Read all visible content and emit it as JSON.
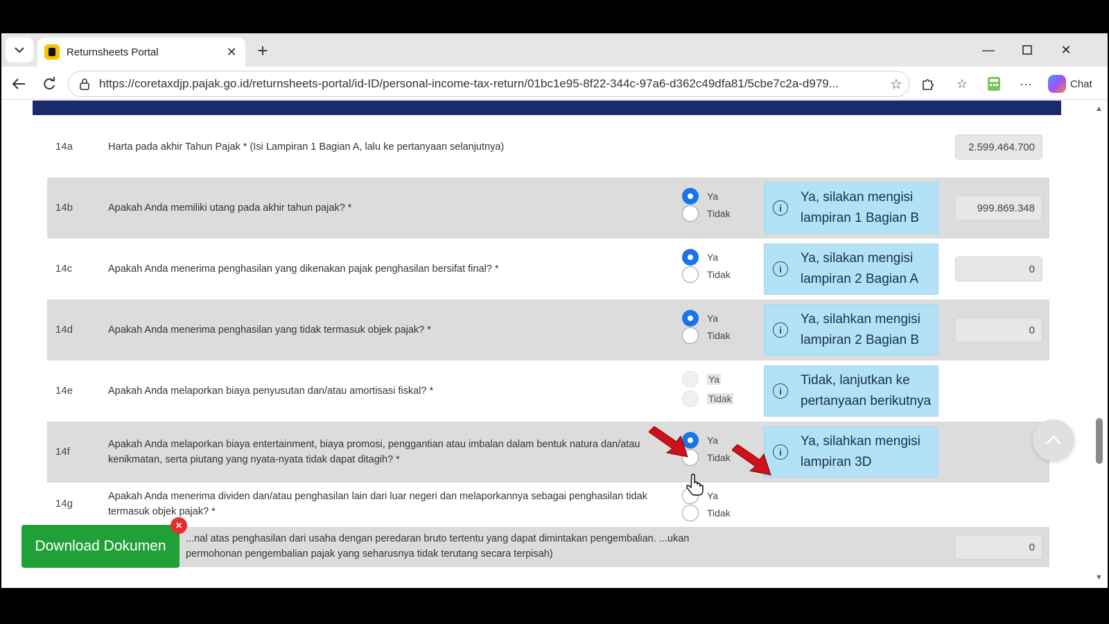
{
  "browser": {
    "tab_title": "Returnsheets Portal",
    "url": "https://coretaxdjp.pajak.go.id/returnsheets-portal/id-ID/personal-income-tax-return/01bc1e95-8f22-344c-97a6-d362c49dfa81/5cbe7c2a-d979...",
    "chat_label": "Chat"
  },
  "form": {
    "yes_label": "Ya",
    "no_label": "Tidak",
    "rows": [
      {
        "no": "14a",
        "question": "Harta pada akhir Tahun Pajak * (Isi Lampiran 1 Bagian A, lalu ke pertanyaan selanjutnya)",
        "amount": "2.599.464.700"
      },
      {
        "no": "14b",
        "question": "Apakah Anda memiliki utang pada akhir tahun pajak? *",
        "selected": "Ya",
        "info": "Ya, silakan mengisi lampiran 1 Bagian B",
        "amount": "999.869.348"
      },
      {
        "no": "14c",
        "question": "Apakah Anda menerima penghasilan yang dikenakan pajak penghasilan bersifat final? *",
        "selected": "Ya",
        "info": "Ya, silakan mengisi lampiran 2 Bagian A",
        "amount": "0"
      },
      {
        "no": "14d",
        "question": "Apakah Anda menerima penghasilan yang tidak termasuk objek pajak? *",
        "selected": "Ya",
        "info": "Ya, silahkan mengisi lampiran 2 Bagian B",
        "amount": "0"
      },
      {
        "no": "14e",
        "question": "Apakah Anda melaporkan biaya penyusutan dan/atau amortisasi fiskal? *",
        "selected": "",
        "info": "Tidak, lanjutkan ke pertanyaan berikutnya"
      },
      {
        "no": "14f",
        "question": "Apakah Anda melaporkan biaya entertainment, biaya promosi, penggantian atau imbalan dalam bentuk natura dan/atau kenikmatan, serta piutang yang nyata-nyata tidak dapat ditagih? *",
        "selected": "Ya",
        "info": "Ya, silahkan mengisi lampiran 3D"
      },
      {
        "no": "14g",
        "question": "Apakah Anda menerima dividen dan/atau penghasilan lain dari luar negeri dan melaporkannya sebagai penghasilan tidak termasuk objek pajak? *",
        "selected": ""
      },
      {
        "no": "",
        "question": "...nal atas penghasilan dari usaha dengan peredaran bruto tertentu yang dapat dimintakan pengembalian. ...ukan permohonan pengembalian pajak yang seharusnya tidak terutang secara terpisah)",
        "amount": "0"
      }
    ]
  },
  "download_label": "Download Dokumen",
  "colors": {
    "accent": "#1a73e8",
    "info_bg": "#b3e1f5",
    "band": "#1b2a6b",
    "download": "#21a038",
    "arrow": "#d0101c"
  }
}
